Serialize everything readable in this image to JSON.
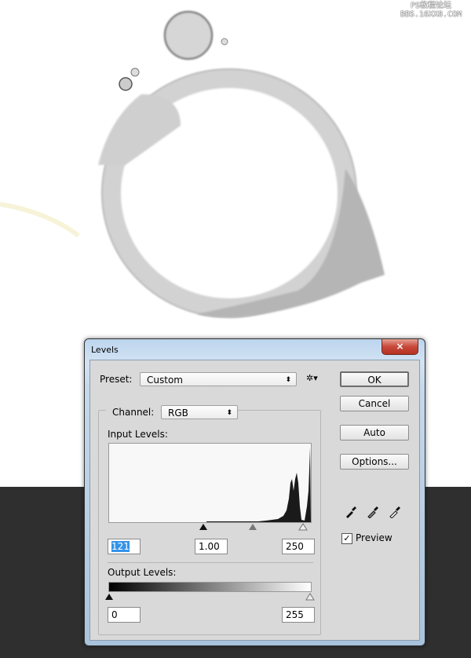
{
  "watermark": {
    "line1": "PS教程论坛",
    "line2": "BBS.16XX8.COM"
  },
  "dialog": {
    "title": "Levels",
    "close_icon": "×",
    "preset_label": "Preset:",
    "preset_value": "Custom",
    "channel_label": "Channel:",
    "channel_value": "RGB",
    "input_levels_label": "Input Levels:",
    "input_black": "121",
    "input_gamma": "1.00",
    "input_white": "250",
    "output_levels_label": "Output Levels:",
    "output_black": "0",
    "output_white": "255",
    "buttons": {
      "ok": "OK",
      "cancel": "Cancel",
      "auto": "Auto",
      "options": "Options..."
    },
    "preview_label": "Preview",
    "preview_checked": true,
    "select_arrow": "⬍",
    "gear_icon": "✲▾",
    "check": "✓"
  },
  "colors": {
    "background_bottom": "#2f2f2f",
    "selection": "#3393e8"
  }
}
